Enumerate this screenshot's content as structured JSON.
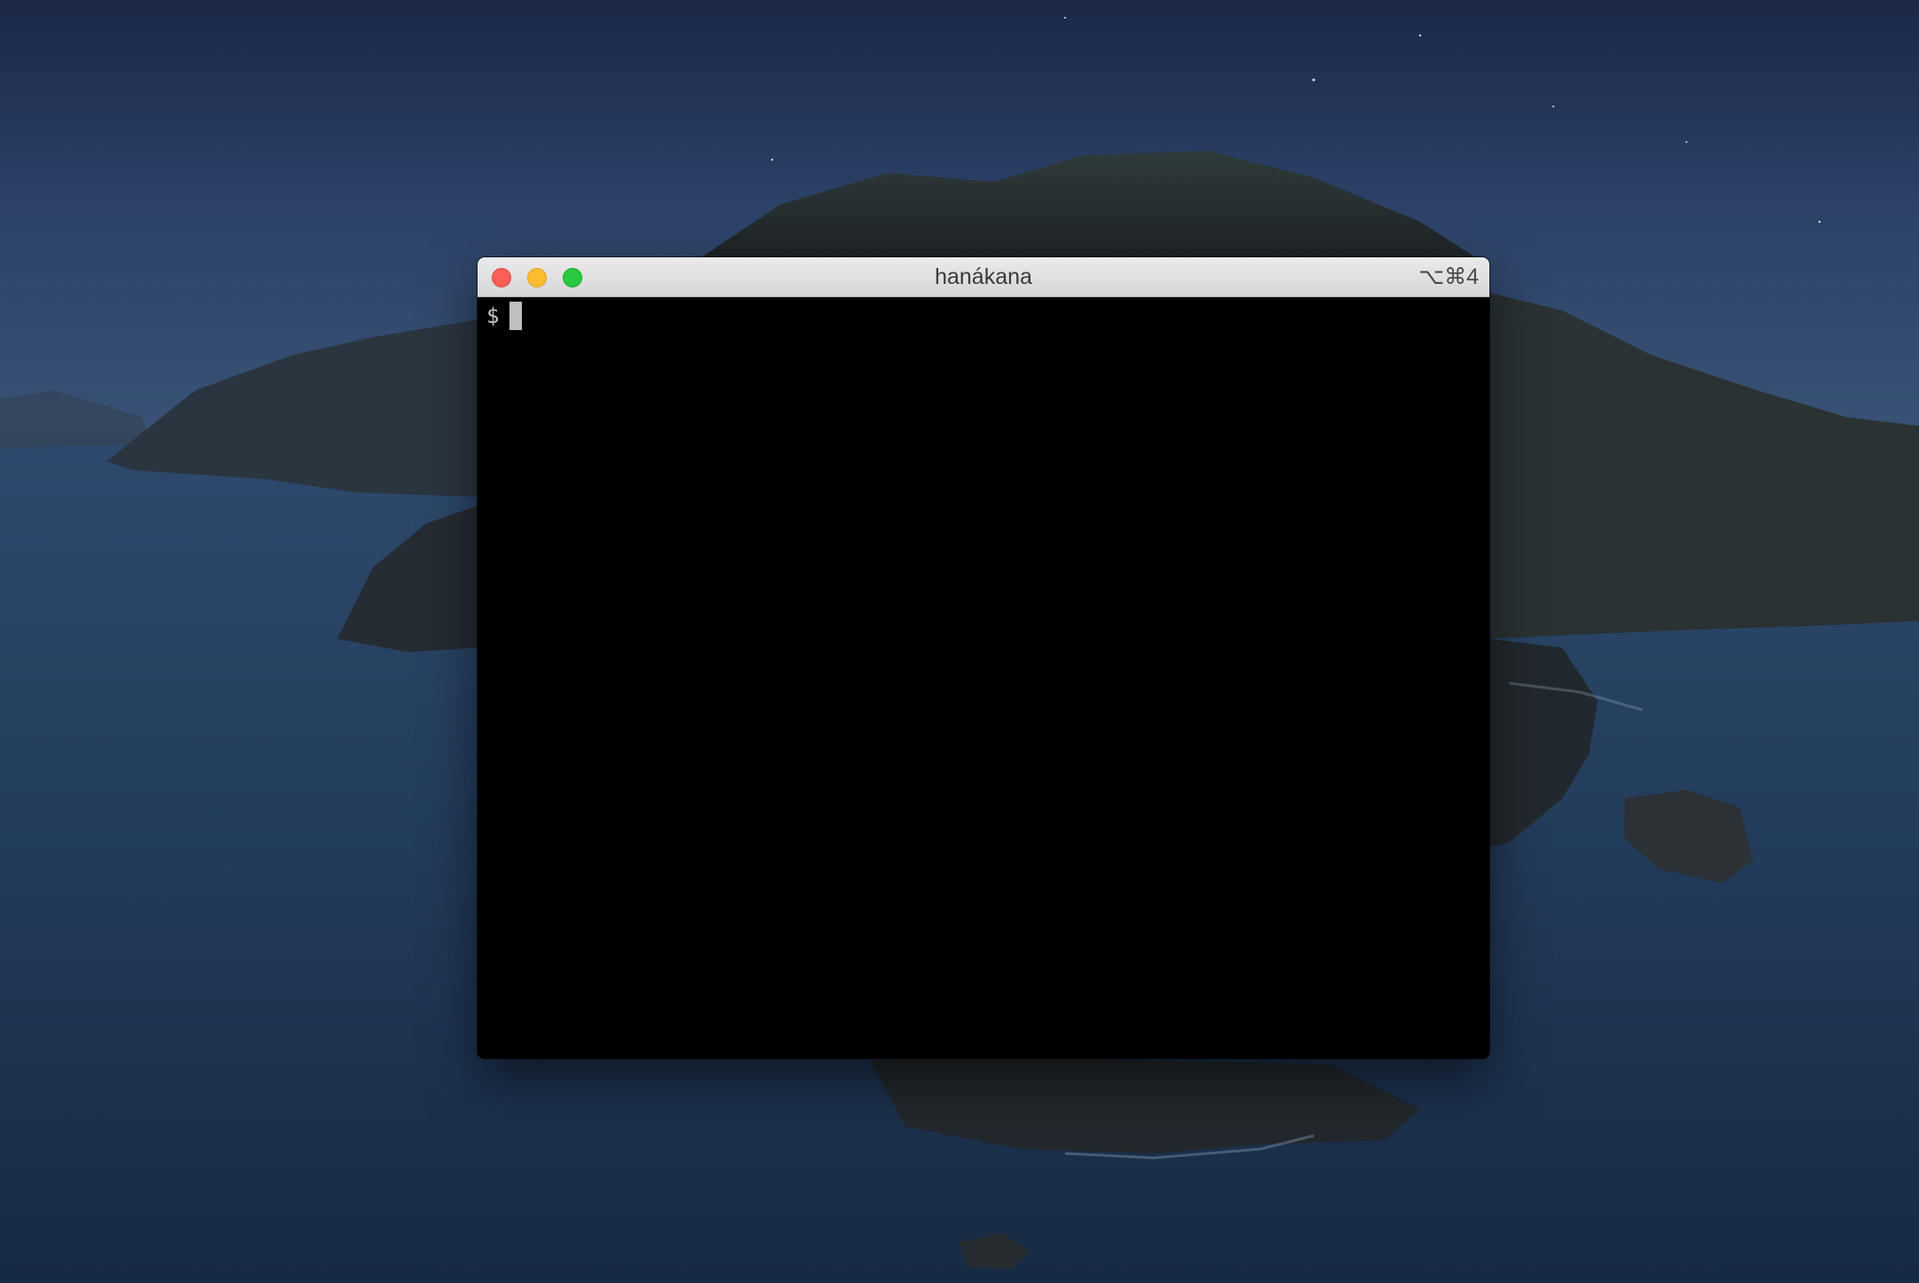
{
  "window": {
    "title": "hanákana",
    "shortcut": "⌥⌘4"
  },
  "terminal": {
    "prompt": "$"
  },
  "colors": {
    "close": "#fc5f57",
    "minimize": "#fdbc2e",
    "zoom": "#28c840",
    "terminal_bg": "#000000"
  },
  "icons": {
    "close": "close-button",
    "minimize": "minimize-button",
    "zoom": "zoom-button"
  }
}
